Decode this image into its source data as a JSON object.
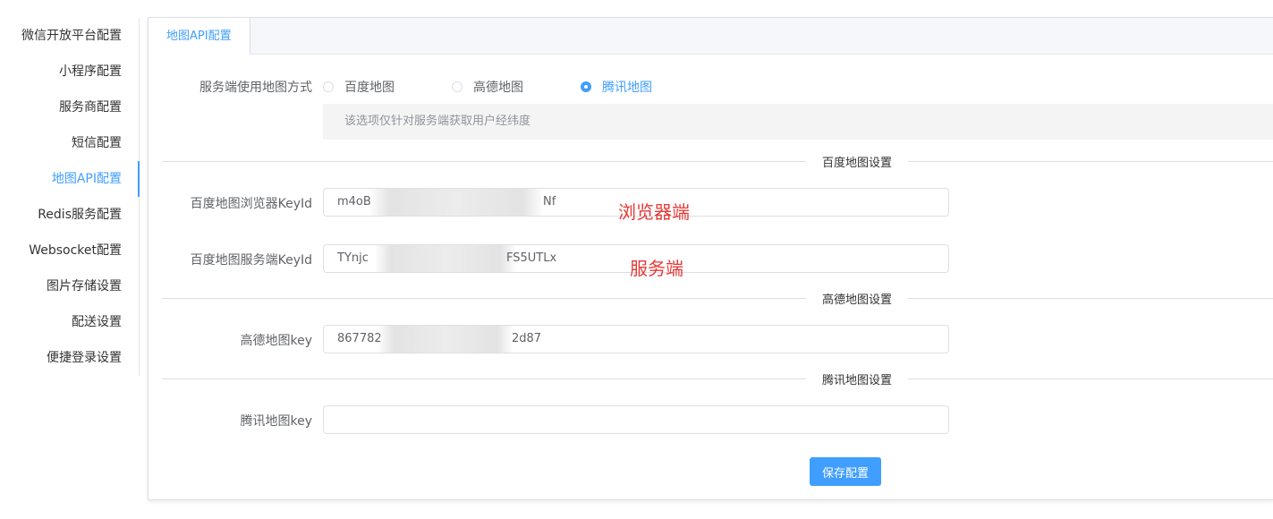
{
  "sidebar": {
    "items": [
      {
        "label": "微信开放平台配置"
      },
      {
        "label": "小程序配置"
      },
      {
        "label": "服务商配置"
      },
      {
        "label": "短信配置"
      },
      {
        "label": "地图API配置"
      },
      {
        "label": "Redis服务配置"
      },
      {
        "label": "Websocket配置"
      },
      {
        "label": "图片存储设置"
      },
      {
        "label": "配送设置"
      },
      {
        "label": "便捷登录设置"
      }
    ],
    "active_index": 4
  },
  "tabs": [
    {
      "label": "地图API配置"
    }
  ],
  "form": {
    "map_mode": {
      "label": "服务端使用地图方式",
      "options": [
        "百度地图",
        "高德地图",
        "腾讯地图"
      ],
      "selected": "腾讯地图",
      "hint": "该选项仅针对服务端获取用户经纬度"
    },
    "baidu_section": "百度地图设置",
    "baidu_browser": {
      "label": "百度地图浏览器KeyId",
      "value_start": "m4oB",
      "value_end": "Nf"
    },
    "baidu_server": {
      "label": "百度地图服务端KeyId",
      "value_start": "TYnjc",
      "value_end": "FS5UTLx"
    },
    "gaode_section": "高德地图设置",
    "gaode_key": {
      "label": "高德地图key",
      "value_start": "867782",
      "value_end": "2d87"
    },
    "tencent_section": "腾讯地图设置",
    "tencent_key": {
      "label": "腾讯地图key",
      "value": ""
    },
    "save_label": "保存配置"
  },
  "annotations": {
    "browser": "浏览器端",
    "server": "服务端"
  },
  "colors": {
    "accent": "#409eff",
    "annotation": "#e53935"
  }
}
